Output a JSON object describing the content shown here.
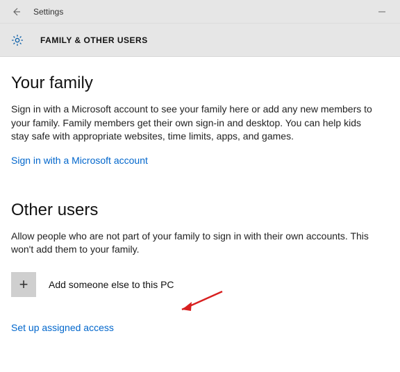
{
  "titlebar": {
    "title": "Settings"
  },
  "header": {
    "heading": "FAMILY & OTHER USERS"
  },
  "family": {
    "title": "Your family",
    "body": "Sign in with a Microsoft account to see your family here or add any new members to your family. Family members get their own sign-in and desktop. You can help kids stay safe with appropriate websites, time limits, apps, and games.",
    "signin_link": "Sign in with a Microsoft account"
  },
  "other": {
    "title": "Other users",
    "body": "Allow people who are not part of your family to sign in with their own accounts. This won't add them to your family.",
    "add_label": "Add someone else to this PC",
    "setup_link": "Set up assigned access"
  }
}
